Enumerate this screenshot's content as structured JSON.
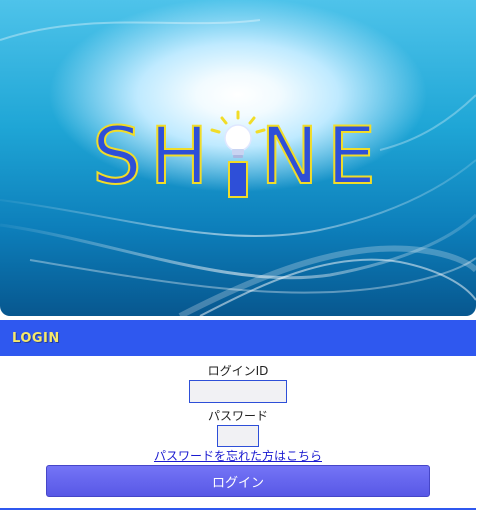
{
  "logo": {
    "text_before": "SH",
    "text_after": "NE"
  },
  "header": {
    "title": "LOGIN"
  },
  "form": {
    "login_id_label": "ログインID",
    "login_id_value": "",
    "password_label": "パスワード",
    "password_value": "",
    "forgot_link": "パスワードを忘れた方はこちら",
    "submit_label": "ログイン"
  },
  "colors": {
    "header_bar": "#2f58ef",
    "header_text": "#f6e96a",
    "logo_fill": "#2e4fd8",
    "logo_outline": "#f1dc28",
    "button": "#6464f0",
    "link": "#1a1ad0"
  },
  "icons": {
    "logo_i": "lightbulb-icon"
  }
}
